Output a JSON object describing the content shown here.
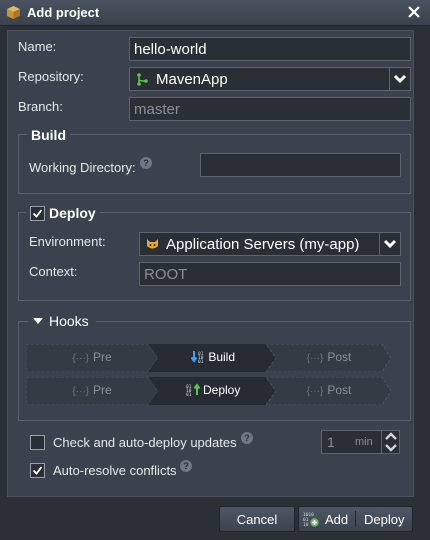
{
  "window": {
    "title": "Add project"
  },
  "form": {
    "name_label": "Name:",
    "name_value": "hello-world",
    "repository_label": "Repository:",
    "repository_value": "MavenApp",
    "branch_label": "Branch:",
    "branch_value": "master"
  },
  "build": {
    "legend": "Build",
    "working_dir_label": "Working Directory:",
    "working_dir_value": ""
  },
  "deploy": {
    "legend": "Deploy",
    "checked": true,
    "environment_label": "Environment:",
    "environment_value": "Application Servers (my-app)",
    "context_label": "Context:",
    "context_value": "ROOT"
  },
  "hooks": {
    "legend": "Hooks",
    "rows": [
      {
        "pre": "Pre",
        "main": "Build",
        "post": "Post"
      },
      {
        "pre": "Pre",
        "main": "Deploy",
        "post": "Post"
      }
    ]
  },
  "options": {
    "auto_deploy_label": "Check and auto-deploy updates",
    "auto_deploy_checked": false,
    "interval_value": "1",
    "interval_unit": "min",
    "auto_resolve_label": "Auto-resolve conflicts",
    "auto_resolve_checked": true
  },
  "footer": {
    "cancel_label": "Cancel",
    "add_label": "Add",
    "deploy_label": "Deploy"
  },
  "colors": {
    "accent_green": "#5fc24a",
    "accent_blue": "#3aa0ff",
    "panel": "#3b424d"
  }
}
